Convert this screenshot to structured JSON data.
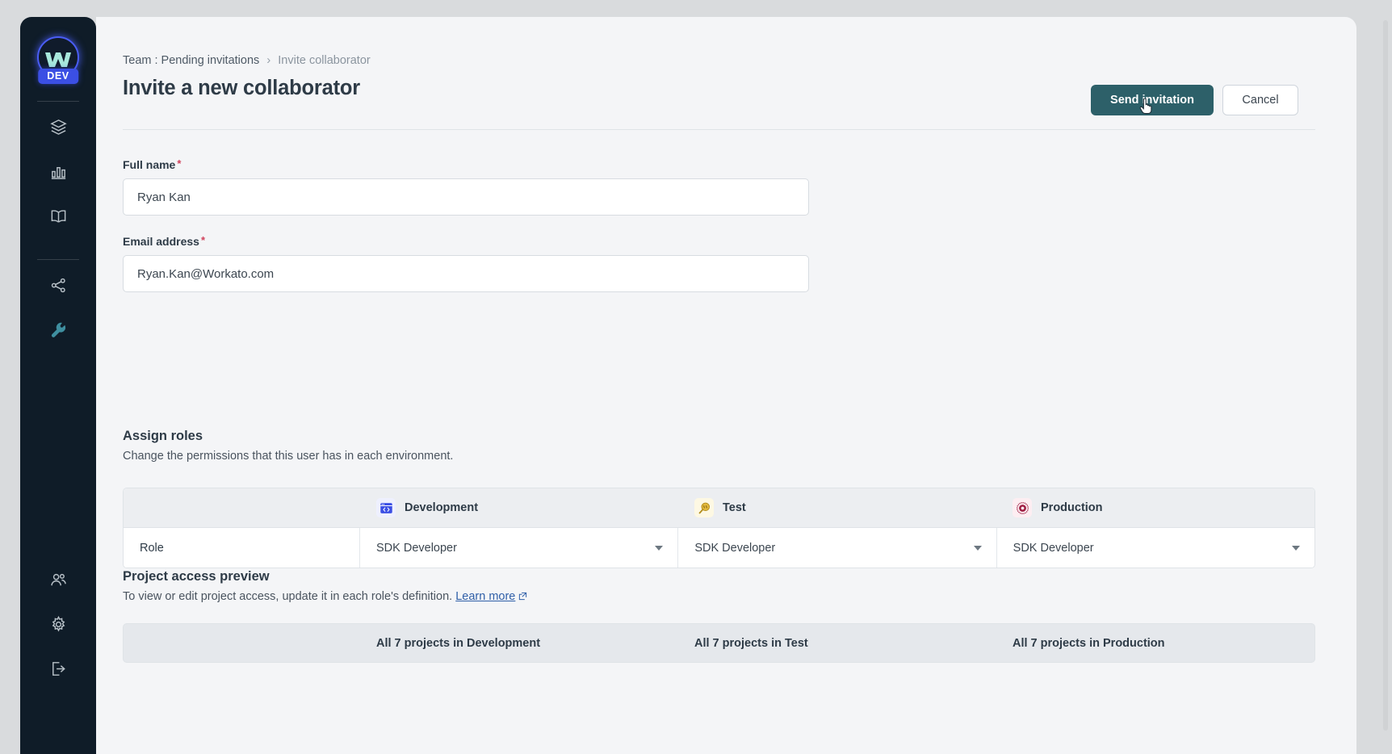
{
  "sidebar": {
    "logo": {
      "name": "workato-logo",
      "badge": "DEV"
    },
    "items": [
      {
        "icon": "layers-icon",
        "label": "Projects"
      },
      {
        "icon": "bar-chart-icon",
        "label": "Insights"
      },
      {
        "icon": "book-icon",
        "label": "Library"
      },
      {
        "icon": "share-network-icon",
        "label": "Connections"
      },
      {
        "icon": "wrench-icon",
        "label": "Tools"
      }
    ],
    "bottom_items": [
      {
        "icon": "users-icon",
        "label": "Team"
      },
      {
        "icon": "gear-icon",
        "label": "Settings"
      },
      {
        "icon": "logout-icon",
        "label": "Log out"
      }
    ]
  },
  "breadcrumb": {
    "parent": "Team : Pending invitations",
    "separator": "›",
    "current": "Invite collaborator"
  },
  "header": {
    "title": "Invite a new collaborator",
    "send_label": "Send invitation",
    "cancel_label": "Cancel",
    "primary_color": "#2d6069"
  },
  "form": {
    "full_name": {
      "label": "Full name",
      "required_marker": "*",
      "value": "Ryan Kan",
      "placeholder": "Full name"
    },
    "email": {
      "label": "Email address",
      "required_marker": "*",
      "value": "Ryan.Kan@Workato.com",
      "placeholder": "Email address"
    }
  },
  "assign_roles": {
    "title": "Assign roles",
    "description": "Change the permissions that this user has in each environment.",
    "row_label": "Role",
    "environments": [
      {
        "name": "Development",
        "icon": "code-window-icon",
        "role": "SDK Developer"
      },
      {
        "name": "Test",
        "icon": "magnifier-icon",
        "role": "SDK Developer"
      },
      {
        "name": "Production",
        "icon": "target-circle-icon",
        "role": "SDK Developer"
      }
    ]
  },
  "project_access": {
    "title": "Project access preview",
    "description": "To view or edit project access, update it in each role's definition.",
    "link_label": "Learn more",
    "cells": [
      "All 7 projects in Development",
      "All 7 projects in Test",
      "All 7 projects in Production"
    ]
  }
}
